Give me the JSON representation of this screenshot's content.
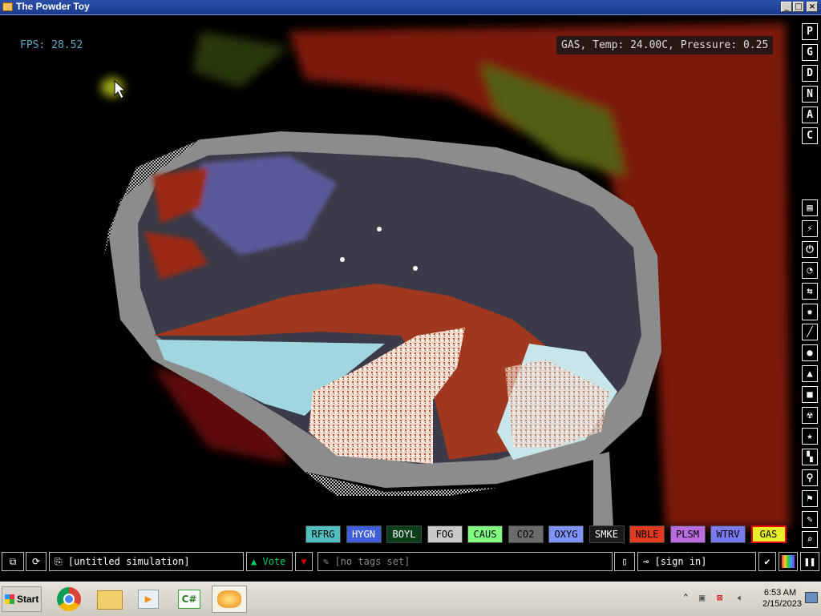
{
  "window": {
    "title": "The Powder Toy"
  },
  "hud": {
    "fps": "FPS: 28.52",
    "info": "GAS, Temp: 24.00C, Pressure: 0.25"
  },
  "render_mode_buttons": [
    "P",
    "G",
    "D",
    "N",
    "A",
    "C"
  ],
  "tool_icons": [
    "wall-icon",
    "electronics-icon",
    "power-icon",
    "sensor-icon",
    "force-icon",
    "explosive-icon",
    "gas-brush-icon",
    "liquid-icon",
    "powder-icon",
    "solid-icon",
    "radioactive-icon",
    "special-icon",
    "life-icon",
    "tools-icon",
    "favorites-icon",
    "deco-icon",
    "search-icon"
  ],
  "elements": [
    {
      "label": "RFRG",
      "bg": "#4fbfbf",
      "fg": "#000000"
    },
    {
      "label": "HYGN",
      "bg": "#3f5fd8",
      "fg": "#ffffff"
    },
    {
      "label": "BOYL",
      "bg": "#0a3f1a",
      "fg": "#ffffff"
    },
    {
      "label": "FOG",
      "bg": "#c8c8c8",
      "fg": "#000000"
    },
    {
      "label": "CAUS",
      "bg": "#80ff80",
      "fg": "#000000"
    },
    {
      "label": "CO2",
      "bg": "#6a6a6a",
      "fg": "#000000"
    },
    {
      "label": "OXYG",
      "bg": "#7f93ff",
      "fg": "#000000"
    },
    {
      "label": "SMKE",
      "bg": "#1a1a1a",
      "fg": "#ffffff"
    },
    {
      "label": "NBLE",
      "bg": "#e23a1c",
      "fg": "#000000"
    },
    {
      "label": "PLSM",
      "bg": "#b96bdf",
      "fg": "#000000"
    },
    {
      "label": "WTRV",
      "bg": "#7b7bf0",
      "fg": "#000000"
    },
    {
      "label": "GAS",
      "bg": "#e8ef2a",
      "fg": "#000000",
      "selected": true
    }
  ],
  "bottom_bar": {
    "sim_name": "[untitled simulation]",
    "vote": "Vote",
    "tags": "[no tags set]",
    "sign_in": "[sign in]"
  },
  "taskbar": {
    "start": "Start",
    "time": "6:53 AM",
    "date": "2/15/2023"
  }
}
